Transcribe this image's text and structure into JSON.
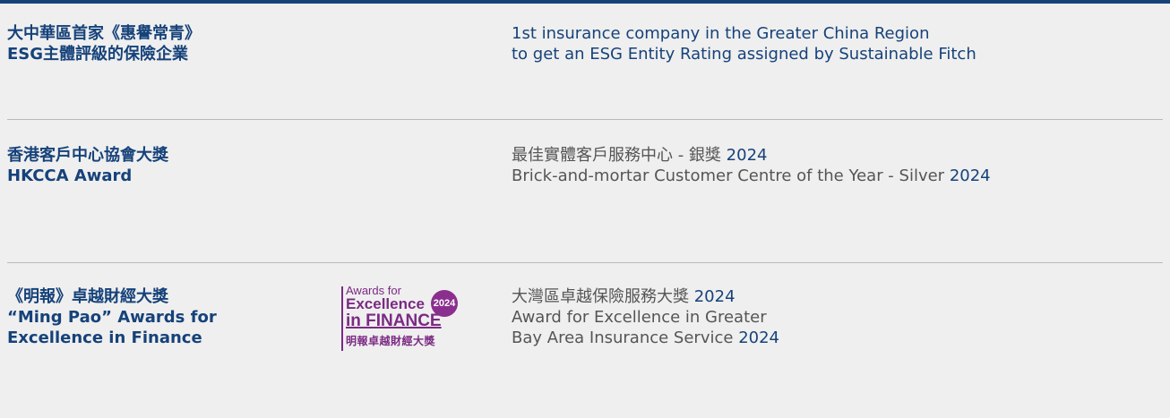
{
  "awards": [
    {
      "title_zh": "大中華區首家《惠譽常青》",
      "title_en": "ESG主體評級的保險企業",
      "desc_line1": "1st insurance company in the Greater China Region",
      "desc_line2": "to get an ESG Entity Rating assigned by Sustainable Fitch"
    },
    {
      "title_zh": "香港客戶中心協會大獎",
      "title_en": "HKCCA Award",
      "desc_line1_text": "最佳實體客戶服務中心 - 銀獎 ",
      "desc_line1_year": "2024",
      "desc_line2_text": "Brick-and-mortar Customer Centre of the Year - Silver ",
      "desc_line2_year": "2024"
    },
    {
      "title_zh": "《明報》卓越財經大獎",
      "title_en_line1": "“Ming Pao” Awards for",
      "title_en_line2": "Excellence in Finance",
      "desc_line1_text": "大灣區卓越保險服務大獎  ",
      "desc_line1_year": "2024",
      "desc_line2_text": "Award for Excellence in Greater",
      "desc_line3_text": "Bay Area Insurance Service ",
      "desc_line3_year": "2024"
    }
  ],
  "logo": {
    "line1": "Awards for",
    "line2": "Excellence",
    "line3": "in FINANCE",
    "line4": "明報卓越財經大獎",
    "badge": "2024"
  },
  "colors": {
    "primary": "#16427a",
    "text_grey": "#555555",
    "background": "#efefef",
    "divider": "#b9b9b9",
    "logo_purple": "#7b2a83"
  }
}
